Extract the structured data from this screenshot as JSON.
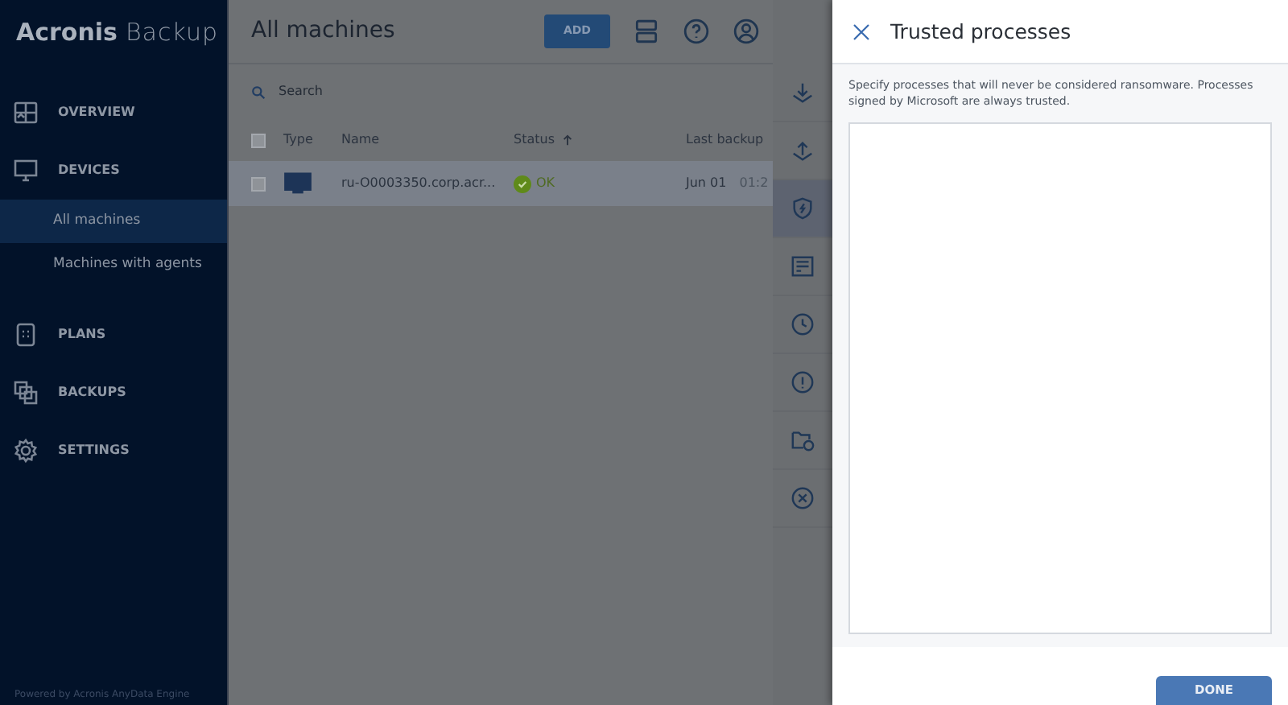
{
  "sidebar": {
    "brand": "Acronis",
    "product": "Backup",
    "items": [
      {
        "label": "OVERVIEW",
        "selected": false
      },
      {
        "label": "DEVICES",
        "selected": false,
        "children": [
          {
            "label": "All machines",
            "selected": true
          },
          {
            "label": "Machines with agents",
            "selected": false
          }
        ]
      },
      {
        "label": "PLANS",
        "selected": false
      },
      {
        "label": "BACKUPS",
        "selected": false
      },
      {
        "label": "SETTINGS",
        "selected": false
      }
    ],
    "footer": "Powered by Acronis AnyData Engine"
  },
  "main": {
    "title": "All machines",
    "add_button": "ADD",
    "search": {
      "placeholder": "Search"
    },
    "table": {
      "select_all_checked": false,
      "columns": [
        {
          "label": "Type",
          "sorted": false
        },
        {
          "label": "Name",
          "sorted": false
        },
        {
          "label": "Status",
          "sorted": true
        },
        {
          "label": "Last backup",
          "sorted": false
        }
      ],
      "rows": [
        {
          "selected": true,
          "checked": false,
          "name": "ru-O0003350.corp.acr...",
          "status": "OK",
          "last_backup_date": "Jun 01",
          "last_backup_time": "01:2"
        }
      ]
    }
  },
  "tools": [
    {
      "selected": false
    },
    {
      "selected": false
    },
    {
      "selected": true
    },
    {
      "selected": false
    },
    {
      "selected": false
    },
    {
      "selected": false
    },
    {
      "selected": false
    },
    {
      "selected": false
    }
  ],
  "panel": {
    "title": "Trusted processes",
    "description": "Specify processes that will never be considered ransomware. Processes signed by Microsoft are always trusted.",
    "done_button": "DONE"
  }
}
